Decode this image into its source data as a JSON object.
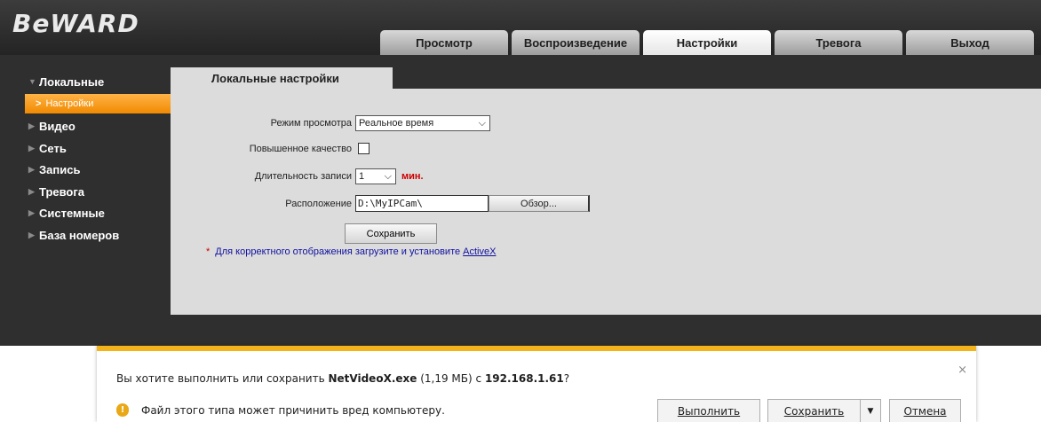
{
  "logo": "BeWARD",
  "tabs": [
    {
      "label": "Просмотр",
      "active": false
    },
    {
      "label": "Воспроизведение",
      "active": false
    },
    {
      "label": "Настройки",
      "active": true
    },
    {
      "label": "Тревога",
      "active": false
    },
    {
      "label": "Выход",
      "active": false
    }
  ],
  "sidebar": {
    "items": [
      {
        "label": "Локальные",
        "expanded": true
      },
      {
        "label": "Видео"
      },
      {
        "label": "Сеть"
      },
      {
        "label": "Запись"
      },
      {
        "label": "Тревога"
      },
      {
        "label": "Системные"
      },
      {
        "label": "База номеров"
      }
    ],
    "sub_item": "Настройки"
  },
  "content": {
    "tab_title": "Локальные настройки",
    "view_mode_label": "Режим просмотра",
    "view_mode_value": "Реальное время",
    "quality_label": "Повышенное качество",
    "duration_label": "Длительность записи",
    "duration_value": "1",
    "duration_unit": "мин.",
    "location_label": "Расположение",
    "location_value": "D:\\MyIPCam\\",
    "browse_button": "Обзор...",
    "save_button": "Сохранить",
    "notice_star": "*",
    "notice_text": "Для корректного отображения загрузите и установите ",
    "notice_link": "ActiveX"
  },
  "download_bar": {
    "question_prefix": "Вы хотите выполнить или сохранить ",
    "file_name": "NetVideoX.exe",
    "file_size": " (1,19 МБ) с ",
    "host": "192.168.1.61",
    "question_suffix": "?",
    "close": "×",
    "warning": "Файл этого типа может причинить вред компьютеру.",
    "run_button": "Выполнить",
    "save_button": "Сохранить",
    "save_dropdown": "▼",
    "cancel_button": "Отмена"
  },
  "colors": {
    "accent_orange": "#f08a00",
    "notification_bar": "#f2b41a"
  }
}
